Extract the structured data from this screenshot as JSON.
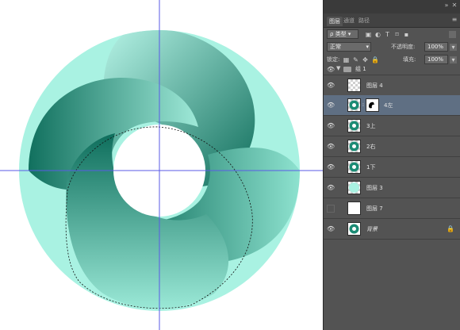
{
  "canvas": {
    "colors": {
      "ring_light": "#a9f2e2",
      "ring_dark": "#0f7360",
      "guide": "#5a5ae6",
      "background": "#ffffff"
    }
  },
  "panel": {
    "tabs": [
      "图层",
      "通道",
      "路径"
    ],
    "active_tab": "图层",
    "close_icon": "double-arrow-icon",
    "menu_icon": "panel-menu-icon",
    "filter": {
      "kind_label": "类型",
      "icons": [
        "image-filter-icon",
        "adjustment-filter-icon",
        "type-filter-icon",
        "shape-filter-icon",
        "smart-object-filter-icon"
      ]
    },
    "blend_mode": "正常",
    "opacity_label": "不透明度:",
    "opacity_value": "100%",
    "lock_label": "锁定:",
    "fill_label": "填充:",
    "fill_value": "100%",
    "layers": [
      {
        "name": "组 1",
        "type": "group",
        "visible": true,
        "selected": false
      },
      {
        "name": "图层 4",
        "type": "layer",
        "visible": true,
        "selected": false
      },
      {
        "name": "4左",
        "type": "masked",
        "visible": true,
        "selected": true
      },
      {
        "name": "3上",
        "type": "layer",
        "visible": true,
        "selected": false
      },
      {
        "name": "2右",
        "type": "layer",
        "visible": true,
        "selected": false
      },
      {
        "name": "1下",
        "type": "layer",
        "visible": true,
        "selected": false
      },
      {
        "name": "图层 3",
        "type": "layer",
        "visible": true,
        "selected": false
      },
      {
        "name": "图层 7",
        "type": "white",
        "visible": false,
        "selected": false
      },
      {
        "name": "背景",
        "type": "background",
        "visible": true,
        "selected": false
      }
    ]
  }
}
